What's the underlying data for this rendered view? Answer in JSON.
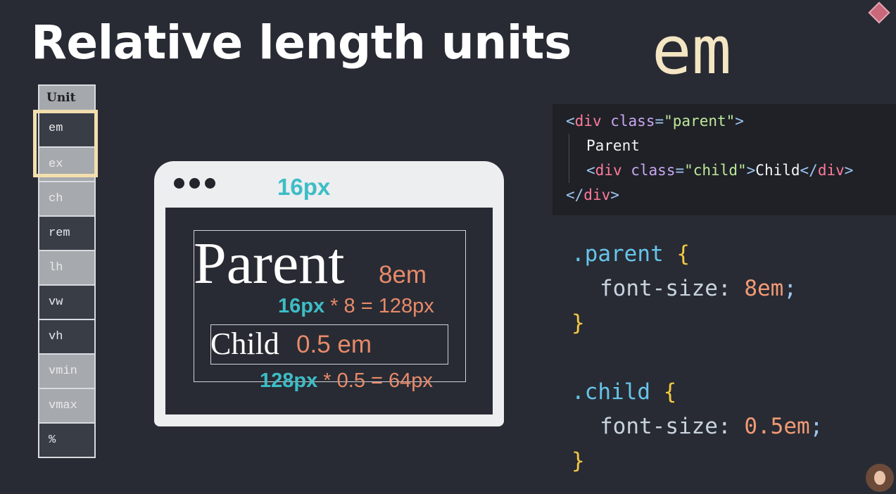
{
  "title": "Relative length units",
  "current_unit": "em",
  "unit_table": {
    "header": "Unit",
    "rows": [
      "em",
      "ex",
      "ch",
      "rem",
      "lh",
      "vw",
      "vh",
      "vmin",
      "vmax",
      "%"
    ],
    "highlighted": "em"
  },
  "browser": {
    "base_font_size": "16px",
    "parent_text": "Parent",
    "parent_unit": "8em",
    "parent_calc_base": "16px",
    "parent_calc_rest": "* 8 = 128px",
    "child_text": "Child",
    "child_unit": "0.5 em",
    "child_calc_base": "128px",
    "child_calc_rest": "* 0.5 = 64px"
  },
  "html_code": {
    "line1_open": "<",
    "line1_tag": "div",
    "line1_attr": "class",
    "line1_eq": "=",
    "line1_val": "\"parent\"",
    "line1_close": ">",
    "line2_text": "Parent",
    "line3_open": "<",
    "line3_tag": "div",
    "line3_attr": "class",
    "line3_eq": "=",
    "line3_val": "\"child\"",
    "line3_close": ">",
    "line3_text": "Child",
    "line3_end_open": "</",
    "line3_end_tag": "div",
    "line3_end_close": ">",
    "line4_open": "</",
    "line4_tag": "div",
    "line4_close": ">"
  },
  "css_code": {
    "parent_selector": ".parent",
    "parent_prop": "font-size",
    "parent_value": "8em",
    "child_selector": ".child",
    "child_prop": "font-size",
    "child_value": "0.5em",
    "open_brace": "{",
    "close_brace": "}",
    "colon": ":",
    "semicolon": ";"
  },
  "colors": {
    "background": "#282b33",
    "teal": "#3dbdc6",
    "orange": "#e88a6a",
    "highlight": "#f3dfae"
  },
  "icons": {
    "logo": "diamond-logo-icon",
    "avatar": "presenter-avatar"
  }
}
